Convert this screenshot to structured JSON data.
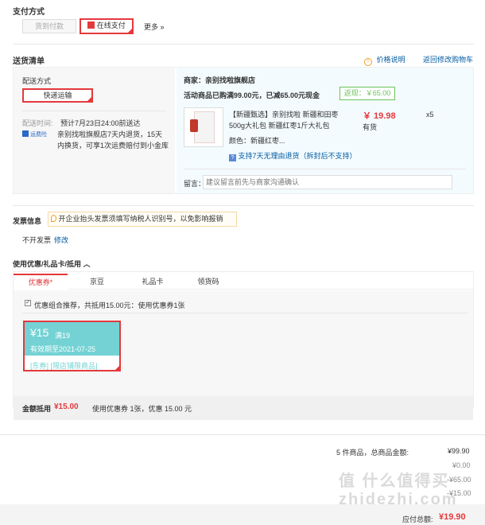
{
  "payment": {
    "title": "支付方式",
    "cod_label": "货到付款",
    "online_label": "在线支付",
    "more_label": "更多 »"
  },
  "shipping": {
    "title": "送货清单",
    "price_note": "价格说明",
    "back_to_cart": "返回修改购物车",
    "method_title": "配送方式",
    "method_value": "快递运输",
    "time_label": "配送时间:",
    "time_value": "预计7月23日24:00前送达",
    "insurance_badge": "运费险",
    "insurance_text": "亲别找啦旗舰店7天内退货，15天内换货，可享1次运费赔付到小金库",
    "merchant": "商家：亲别找啦旗舰店",
    "promo": "活动商品已购满99.00元，已减65.00元现金",
    "cashback": "返现：￥65.00",
    "product_name": "【新疆甄选】亲别找啦 新疆和田枣500g大礼包 新疆红枣1斤大礼包",
    "product_price": "￥ 19.98",
    "product_qty": "x5",
    "product_stock": "有货",
    "product_color": "颜色：新疆红枣...",
    "return_policy": "支持7天无理由退货（拆封后不支持）",
    "note_label": "留言：",
    "note_placeholder": "建议留言前先与商家沟通确认"
  },
  "invoice": {
    "title": "发票信息",
    "tip": "开企业抬头发票须填写纳税人识别号，以免影响报销",
    "status": "不开发票",
    "modify": "修改"
  },
  "discount": {
    "title": "使用优惠/礼品卡/抵用 ︿",
    "tabs": [
      "优惠券*",
      "京豆",
      "礼品卡",
      "领货码"
    ],
    "combo_text": "优惠组合推荐，共抵用15.00元：使用优惠券1张",
    "coupon_amount": "¥15",
    "coupon_threshold": "满19",
    "coupon_valid": "有效期至2021-07-25",
    "coupon_tags": "[东券] [限店铺限商品]",
    "summary_label": "金额抵用",
    "summary_amount": "¥15.00",
    "summary_text": "使用优惠券 1张，优惠 15.00 元"
  },
  "totals": {
    "count_text": "5 件商品，总商品金额:",
    "goods_amount": "¥99.90",
    "row2": "¥0.00",
    "row3": "-¥65.00",
    "row4": "-¥15.00",
    "payable_label": "应付总额:",
    "payable_amount": "¥19.90"
  },
  "watermark": "值 什么值得买 zhidezhi.com"
}
